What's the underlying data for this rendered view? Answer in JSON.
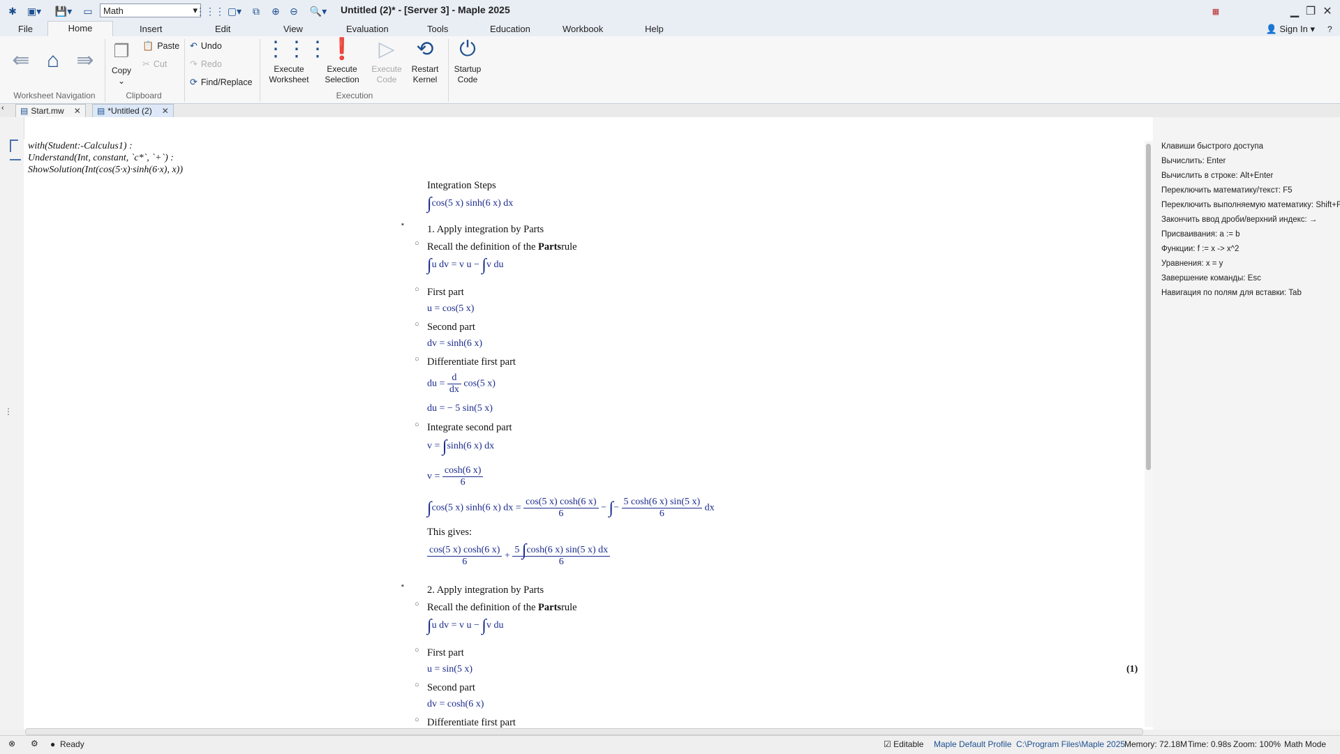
{
  "window": {
    "title": "Untitled (2)* - [Server 3] - Maple 2025",
    "mode_value": "Math"
  },
  "menu": {
    "tabs": [
      "File",
      "Home",
      "Insert",
      "Edit",
      "View",
      "Evaluation",
      "Tools",
      "Education",
      "Workbook",
      "Help"
    ],
    "signin": "Sign In"
  },
  "ribbon": {
    "groups": {
      "nav": "Worksheet Navigation",
      "clipboard": "Clipboard",
      "execution": "Execution"
    },
    "copy": "Copy",
    "paste": "Paste",
    "cut": "Cut",
    "undo": "Undo",
    "redo": "Redo",
    "find_replace": "Find/Replace",
    "execute_worksheet": [
      "Execute",
      "Worksheet"
    ],
    "execute_selection": [
      "Execute",
      "Selection"
    ],
    "execute_code": [
      "Execute",
      "Code"
    ],
    "restart_kernel": [
      "Restart",
      "Kernel"
    ],
    "startup_code": [
      "Startup",
      "Code"
    ]
  },
  "doc_tabs": [
    {
      "label": "Start.mw",
      "active": false
    },
    {
      "label": "*Untitled (2)",
      "active": true
    }
  ],
  "input": {
    "line1": "with(Student:-Calculus1) :",
    "line2": "Understand(Int, constant, `c*`, `+`) :",
    "line3": "ShowSolution(Int(cos(5·x)·sinh(6·x), x))"
  },
  "solution": {
    "heading": "Integration Steps",
    "integral": "cos(5 x) sinh(6 x) dx",
    "step1": "1. Apply integration by Parts",
    "recall_a": "Recall the definition of the",
    "recall_b": "Parts",
    "recall_c": "rule",
    "parts_rule": "u dv = v u −",
    "parts_rule_end": "v du",
    "first_part": "First part",
    "u1": "u = cos(5 x)",
    "second_part": "Second part",
    "dv1": "dv = sinh(6 x)",
    "diff_first": "Differentiate first part",
    "du_lhs": "du =",
    "du_num": "d",
    "du_den": "dx",
    "du_rhs": "cos(5 x)",
    "du_result": "du = − 5 sin(5 x)",
    "int_second": "Integrate second part",
    "v_int_lhs": "v =",
    "v_int_rhs": "sinh(6 x) dx",
    "v_lhs": "v =",
    "v_num": "cosh(6 x)",
    "v_den": "6",
    "res_lhs": "cos(5 x) sinh(6 x) dx =",
    "res_f1_num": "cos(5 x) cosh(6 x)",
    "res_f1_den": "6",
    "res_minus": "−",
    "res_f2_num": "5 cosh(6 x) sin(5 x)",
    "res_f2_den": "6",
    "res_dx": "dx",
    "this_gives": "This gives:",
    "g_f1_num": "cos(5 x) cosh(6 x)",
    "g_f1_den": "6",
    "g_plus": "+",
    "g_f2_num_a": "5",
    "g_f2_num_b": "cosh(6 x) sin(5 x) dx",
    "g_f2_den": "6",
    "step2": "2. Apply integration by Parts",
    "u2": "u = sin(5 x)",
    "dv2": "dv = cosh(6 x)",
    "diff_first2": "Differentiate first part",
    "eq_label": "(1)"
  },
  "shortcuts": {
    "title": "Клавиши быстрого доступа",
    "items": [
      "Вычислить:  Enter",
      "Вычислить в строке:  Alt+Enter",
      "Переключить математику/текст:  F5",
      "Переключить выполняемую математику:  Shift+F5",
      "Закончить ввод дроби/верхний индекс:  →",
      "Присваивания:  a := b",
      "Функции:  f := x -> x^2",
      "Уравнения:  x = y",
      "Завершение команды:  Esc",
      "Навигация по полям для вставки:  Tab"
    ]
  },
  "status": {
    "ready": "Ready",
    "editable": "Editable",
    "profile": "Maple Default Profile",
    "path": "C:\\Program Files\\Maple 2025",
    "memory": "Memory: 72.18M",
    "time": "Time: 0.98s",
    "zoom": "Zoom: 100%",
    "mode": "Math Mode"
  }
}
